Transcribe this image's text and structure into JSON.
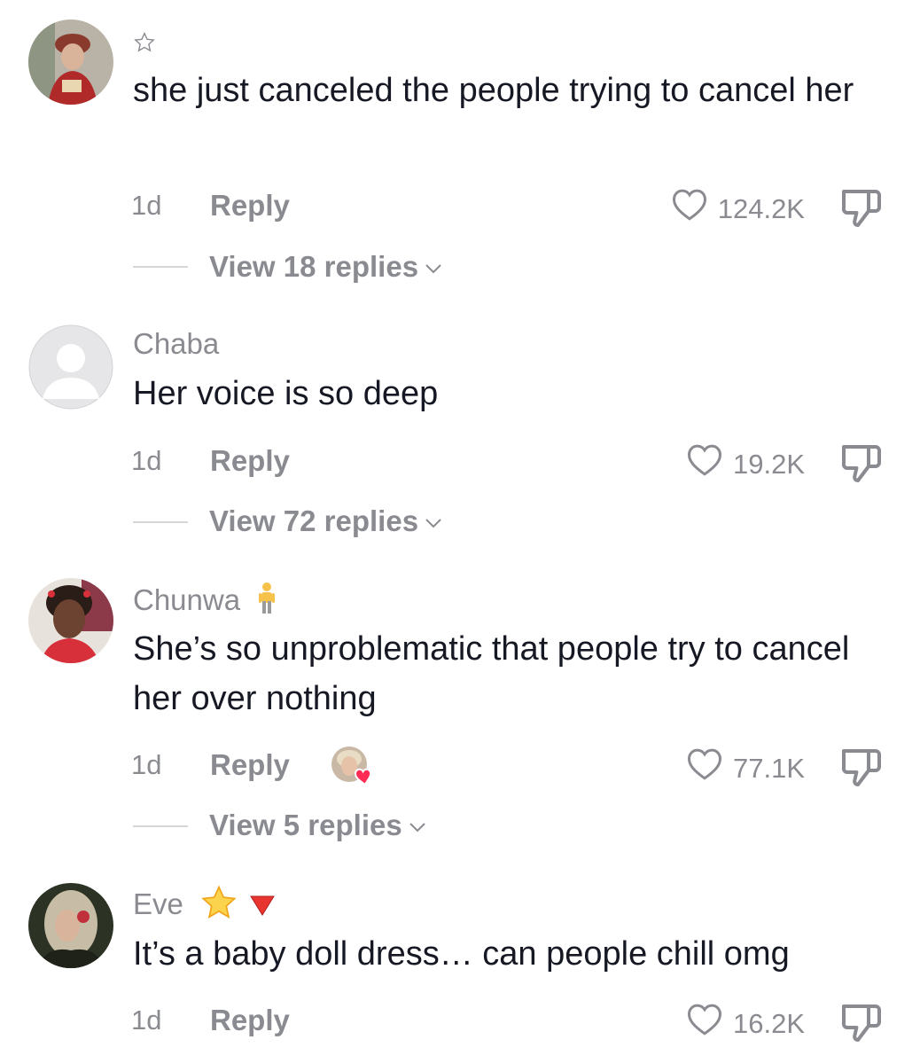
{
  "comments": [
    {
      "username": "",
      "badge_icon": "star-outline-icon",
      "text": "she just canceled the people trying to cancel her",
      "time": "1d",
      "reply_label": "Reply",
      "likes": "124.2K",
      "view_replies": "View 18 replies"
    },
    {
      "username": "Chaba",
      "text": "Her voice is so deep",
      "time": "1d",
      "reply_label": "Reply",
      "likes": "19.2K",
      "view_replies": "View 72 replies"
    },
    {
      "username": "Chunwa",
      "badge_icon": "person-standing-emoji",
      "text": "She’s so unproblematic that people try to cancel her over nothing",
      "time": "1d",
      "reply_label": "Reply",
      "likes": "77.1K",
      "liked_by_creator_icon": "creator-heart-avatar",
      "view_replies": "View 5 replies"
    },
    {
      "username": "Eve",
      "badge_icons": [
        "star-emoji",
        "red-triangle-down-emoji"
      ],
      "text": "It’s a baby doll dress… can people chill omg",
      "time": "1d",
      "reply_label": "Reply",
      "likes": "16.2K"
    }
  ],
  "colors": {
    "text": "#161823",
    "muted": "#8a8b91",
    "divider": "#d6d6d9",
    "heart_badge": "#fe2c55"
  }
}
